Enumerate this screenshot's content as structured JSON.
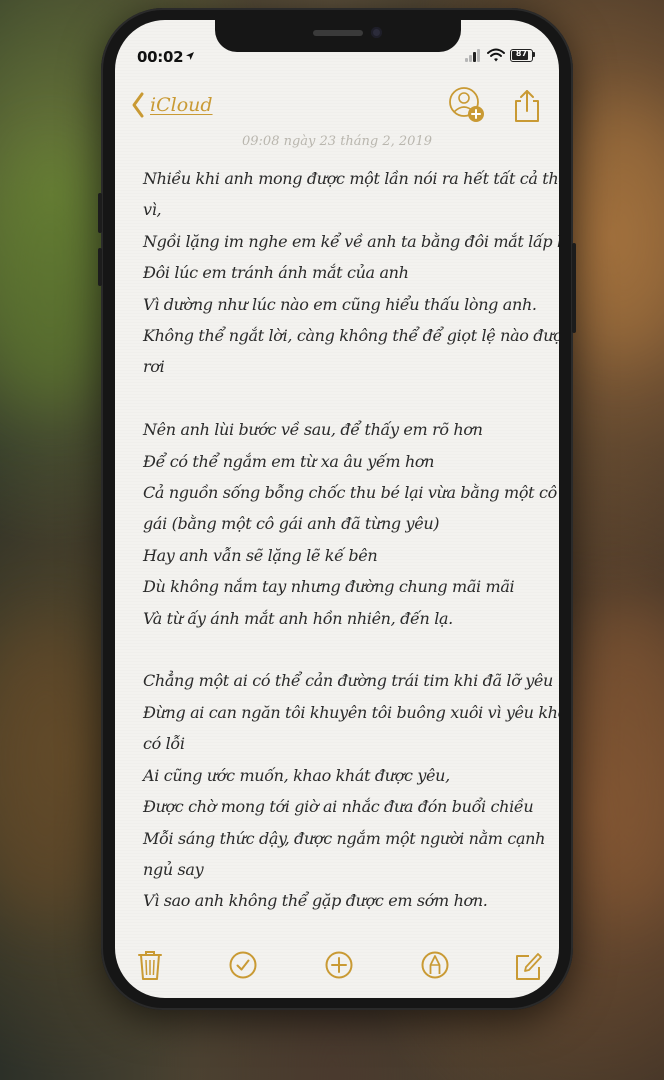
{
  "status_bar": {
    "time": "00:02",
    "battery_label": "87"
  },
  "nav": {
    "back_label": "iCloud"
  },
  "note": {
    "date": "09:08 ngày 23 tháng 2, 2019",
    "lines": [
      "Nhiều khi anh mong được một lần nói ra hết tất cả thay",
      "vì,",
      "Ngồi lặng im nghe em kể về anh ta bằng đôi mắt lấp lánh",
      "Đôi lúc em tránh ánh mắt của anh",
      "Vì dường như lúc nào em cũng hiểu thấu lòng anh.",
      "Không thể ngắt lời, càng không thể để giọt lệ nào được",
      "rơi",
      "",
      "Nên anh lùi bước về sau, để thấy em rõ hơn",
      "Để có thể ngắm em từ xa âu yếm hơn",
      "Cả nguồn sống bỗng chốc thu bé lại vừa bằng một cô",
      "gái (bằng một cô gái anh đã từng yêu)",
      "Hay anh vẫn sẽ lặng lẽ kế bên",
      "Dù không nắm tay nhưng đường chung mãi mãi",
      "Và từ ấy ánh mắt anh hồn nhiên, đến lạ.",
      "",
      "Chẳng một ai có thể cản đường trái tim khi đã lỡ yêu rồi",
      "Đừng ai can ngăn tôi khuyên tôi buông xuôi vì yêu không",
      "có lỗi",
      "Ai cũng ước muốn, khao khát được yêu,",
      "Được chờ mong tới giờ ai nhắc đưa đón buổi chiều",
      "Mỗi sáng thức dậy, được ngắm một người nằm cạnh",
      "ngủ say",
      "Vì sao anh không thể gặp được em sớm hơn."
    ]
  },
  "toolbar": {
    "items": [
      "trash-icon",
      "checklist-icon",
      "add-icon",
      "markup-icon",
      "compose-icon"
    ]
  },
  "colors": {
    "accent": "#c99a34",
    "text": "#2a2a2a",
    "date": "#b9b6ae",
    "paper": "#f3f2ef"
  }
}
